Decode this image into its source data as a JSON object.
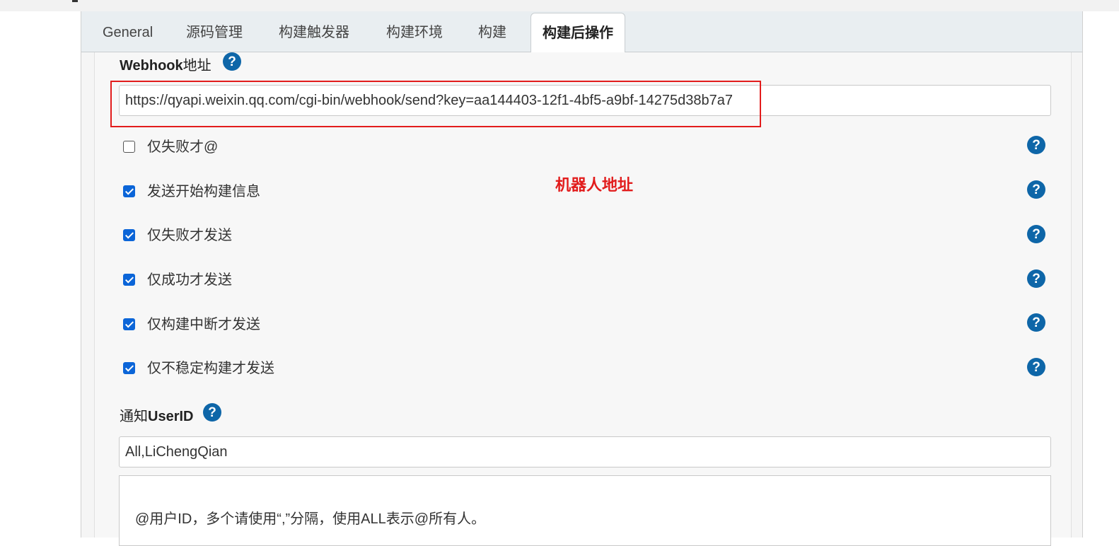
{
  "tabs": [
    {
      "label": "General"
    },
    {
      "label": "源码管理"
    },
    {
      "label": "构建触发器"
    },
    {
      "label": "构建环境"
    },
    {
      "label": "构建"
    },
    {
      "label": "构建后操作"
    }
  ],
  "active_tab": "构建后操作",
  "webhook": {
    "label_bold": "Webhook",
    "label_rest": "地址",
    "value": "https://qyapi.weixin.qq.com/cgi-bin/webhook/send?key=aa144403-12f1-4bf5-a9bf-14275d38b7a7"
  },
  "annotation": "机器人地址",
  "options": [
    {
      "label": "仅失败才@",
      "checked": false
    },
    {
      "label": "发送开始构建信息",
      "checked": true
    },
    {
      "label": "仅失败才发送",
      "checked": true
    },
    {
      "label": "仅成功才发送",
      "checked": true
    },
    {
      "label": "仅构建中断才发送",
      "checked": true
    },
    {
      "label": "仅不稳定构建才发送",
      "checked": true
    }
  ],
  "notify": {
    "label_rest": "通知",
    "label_bold": "UserID",
    "value": "All,LiChengQian",
    "description": "@用户ID，多个请使用“,”分隔，使用ALL表示@所有人。"
  },
  "help_symbol": "?",
  "colors": {
    "help_icon": "#0e66a8",
    "checkbox_checked": "#0b65d8",
    "annotation_red": "#e21c1c"
  }
}
